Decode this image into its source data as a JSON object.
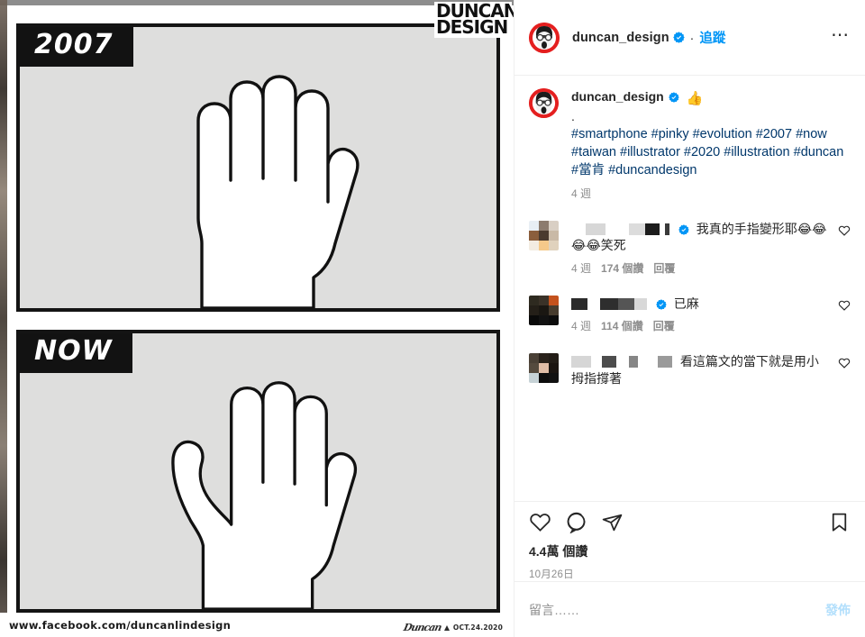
{
  "post_image": {
    "watermark_logo_line1": "DUNCAN",
    "watermark_logo_line2": "DESIGN",
    "panels": [
      {
        "label": "2007",
        "hand": "normal-pinky"
      },
      {
        "label": "NOW",
        "hand": "bent-pinky"
      }
    ],
    "footer_url": "www.facebook.com/duncanlindesign",
    "signature": "Duncan",
    "signature_date": "OCT.24.2020"
  },
  "header": {
    "username": "duncan_design",
    "verified_icon": "verified-badge-icon",
    "separator": "·",
    "follow_label": "追蹤",
    "more_icon": "more-options-icon",
    "avatar_icon": "duncan-avatar"
  },
  "caption": {
    "username": "duncan_design",
    "verified_icon": "verified-badge-icon",
    "emoji": "👍",
    "dot_line": ".",
    "hashtags": "#smartphone #pinky #evolution #2007 #now #taiwan #illustrator #2020 #illustration #duncan #當肯 #duncandesign",
    "timestamp": "4 週"
  },
  "comments": [
    {
      "username_redacted": true,
      "verified_icon": "verified-badge-icon",
      "text": "我真的手指變形耶😂😂😂😂笑死",
      "timestamp": "4 週",
      "likes": "174 個讚",
      "reply_label": "回覆",
      "like_icon": "heart-outline-icon"
    },
    {
      "username_redacted": true,
      "verified_icon": "verified-badge-icon",
      "text": "已麻",
      "timestamp": "4 週",
      "likes": "114 個讚",
      "reply_label": "回覆",
      "like_icon": "heart-outline-icon"
    },
    {
      "username_redacted": true,
      "verified_icon": null,
      "text": "看這篇文的當下就是用小拇指撐著",
      "timestamp": "",
      "likes": "",
      "reply_label": "",
      "like_icon": "heart-outline-icon"
    }
  ],
  "actions": {
    "like_icon": "heart-outline-icon",
    "comment_icon": "comment-bubble-icon",
    "share_icon": "share-paperplane-icon",
    "save_icon": "bookmark-outline-icon",
    "likes_count": "4.4萬 個讚",
    "post_date": "10月26日"
  },
  "compose": {
    "placeholder": "留言……",
    "value": "",
    "post_label": "發佈"
  },
  "colors": {
    "link_blue": "#00376b",
    "accent_blue": "#0095f6",
    "post_btn_blue": "#b2dffc",
    "text": "#262626",
    "muted": "#8e8e8e",
    "divider": "#efefef",
    "panel_bg": "#dededd",
    "ink": "#141414",
    "avatar_ring": "#e41f1f"
  }
}
